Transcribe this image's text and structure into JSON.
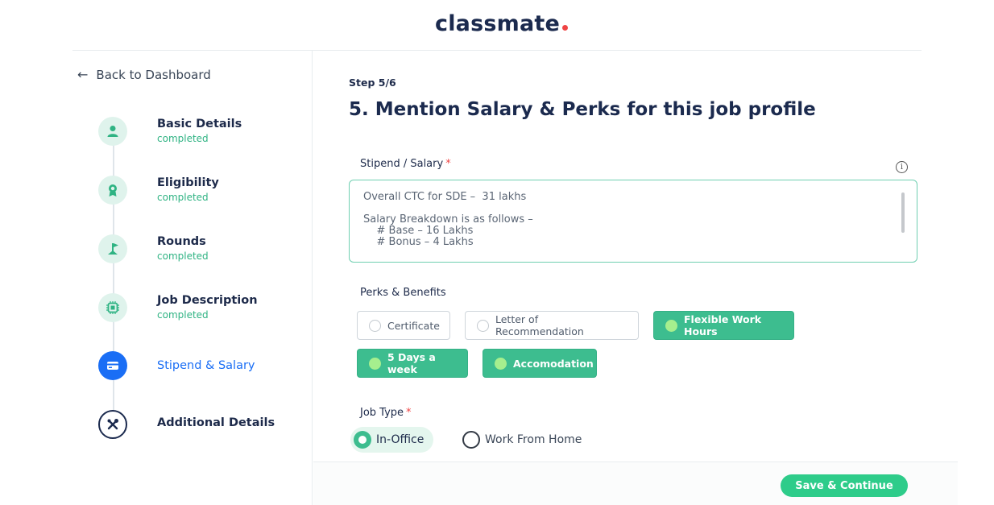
{
  "app": {
    "logo": "classmate"
  },
  "sidebar": {
    "back_label": "Back to Dashboard",
    "steps": [
      {
        "title": "Basic Details",
        "status": "completed",
        "icon": "user-icon"
      },
      {
        "title": "Eligibility",
        "status": "completed",
        "icon": "award-icon"
      },
      {
        "title": "Rounds",
        "status": "completed",
        "icon": "flag-icon"
      },
      {
        "title": "Job Description",
        "status": "completed",
        "icon": "chip-icon"
      },
      {
        "title": "Stipend & Salary",
        "status": "",
        "icon": "card-icon"
      },
      {
        "title": "Additional Details",
        "status": "",
        "icon": "tools-icon"
      }
    ]
  },
  "main": {
    "step_label": "Step 5/6",
    "title": "5. Mention Salary & Perks for this job profile",
    "salary": {
      "label": "Stipend / Salary",
      "required_mark": "*",
      "info_glyph": "i",
      "lines": [
        "Overall CTC for SDE –  31 lakhs",
        "",
        "Salary Breakdown is as follows –",
        "    # Base – 16 Lakhs",
        "    # Bonus – 4 Lakhs"
      ]
    },
    "perks": {
      "label": "Perks & Benefits",
      "options": [
        {
          "label": "Certificate",
          "selected": false
        },
        {
          "label": "Letter of Recommendation",
          "selected": false
        },
        {
          "label": "Flexible Work Hours",
          "selected": true
        },
        {
          "label": "5 Days a week",
          "selected": true
        },
        {
          "label": "Accomodation",
          "selected": true
        }
      ]
    },
    "job_type": {
      "label": "Job Type",
      "required_mark": "*",
      "options": [
        {
          "label": "In-Office",
          "selected": true
        },
        {
          "label": "Work From Home",
          "selected": false
        }
      ]
    }
  },
  "footer": {
    "save_label": "Save & Continue"
  },
  "colors": {
    "accent": "#3dbd8f",
    "active_step": "#1a6ef5",
    "brand_dark": "#1b2a4e",
    "logo_dot": "#ef4444"
  }
}
